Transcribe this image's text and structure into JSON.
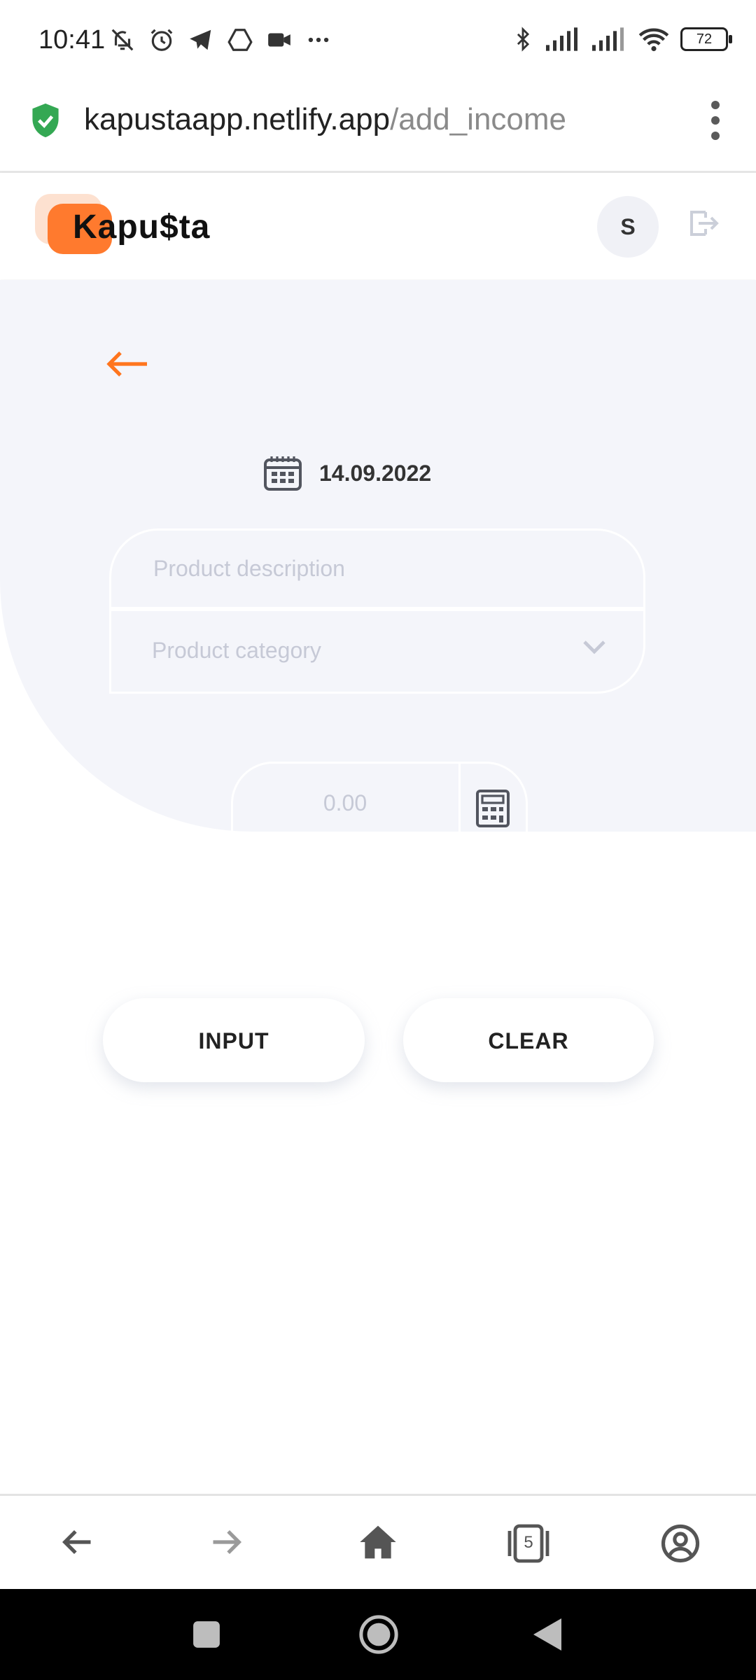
{
  "status_bar": {
    "time": "10:41",
    "left_icons": [
      "bell-off-icon",
      "alarm-icon",
      "telegram-icon",
      "drive-icon",
      "video-icon",
      "more-icon"
    ],
    "right_icons": [
      "bluetooth-icon",
      "signal-icon",
      "signal-icon",
      "wifi-icon"
    ],
    "battery": "72"
  },
  "browser": {
    "url_host": "kapustaapp.netlify.app",
    "url_path": "/add_income",
    "tab_count": "5"
  },
  "header": {
    "logo_text": "Kapu$ta",
    "avatar_initial": "S"
  },
  "form": {
    "date": "14.09.2022",
    "description_placeholder": "Product description",
    "category_placeholder": "Product category",
    "amount_placeholder": "0.00"
  },
  "buttons": {
    "input_label": "INPUT",
    "clear_label": "CLEAR"
  },
  "colors": {
    "accent": "#ff751d",
    "hero_bg": "#f4f5fa",
    "placeholder": "#c6c9d6"
  }
}
